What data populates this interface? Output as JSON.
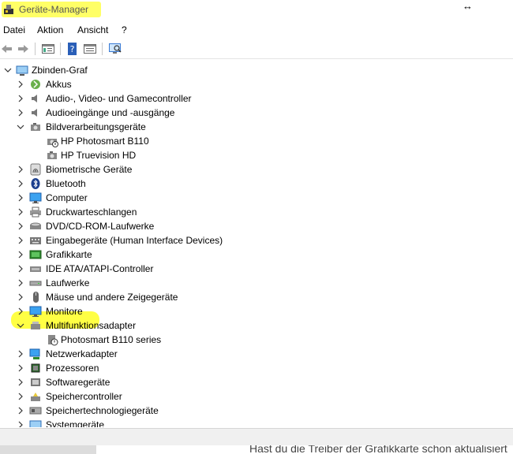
{
  "window": {
    "title": "Geräte-Manager",
    "app_icon": "device-manager-icon",
    "resize_glyph": "↔"
  },
  "menu": {
    "items": [
      "Datei",
      "Aktion",
      "Ansicht",
      "?"
    ]
  },
  "toolbar": {
    "buttons": [
      "back-arrow-icon",
      "forward-arrow-icon",
      "properties-view-icon",
      "help-icon",
      "details-view-icon",
      "scan-hardware-icon"
    ]
  },
  "tree": {
    "root": "Zbinden-Graf",
    "items": [
      {
        "label": "Akkus",
        "icon": "battery-icon",
        "expanded": false
      },
      {
        "label": "Audio-, Video- und Gamecontroller",
        "icon": "speaker-icon",
        "expanded": false
      },
      {
        "label": "Audioeingänge und -ausgänge",
        "icon": "speaker-icon",
        "expanded": false
      },
      {
        "label": "Bildverarbeitungsgeräte",
        "icon": "camera-icon",
        "expanded": true
      },
      {
        "label": "HP Photosmart B110",
        "icon": "camera-warning-icon",
        "child": true
      },
      {
        "label": "HP Truevision HD",
        "icon": "camera-icon",
        "child": true
      },
      {
        "label": "Biometrische Geräte",
        "icon": "fingerprint-icon",
        "expanded": false
      },
      {
        "label": "Bluetooth",
        "icon": "bluetooth-icon",
        "expanded": false
      },
      {
        "label": "Computer",
        "icon": "monitor-icon",
        "expanded": false
      },
      {
        "label": "Druckwarteschlangen",
        "icon": "printer-icon",
        "expanded": false
      },
      {
        "label": "DVD/CD-ROM-Laufwerke",
        "icon": "disc-drive-icon",
        "expanded": false
      },
      {
        "label": "Eingabegeräte (Human Interface Devices)",
        "icon": "keyboard-icon",
        "expanded": false
      },
      {
        "label": "Grafikkarte",
        "icon": "display-adapter-icon",
        "expanded": false,
        "highlighted": true
      },
      {
        "label": "IDE ATA/ATAPI-Controller",
        "icon": "ide-controller-icon",
        "expanded": false
      },
      {
        "label": "Laufwerke",
        "icon": "disk-drive-icon",
        "expanded": false
      },
      {
        "label": "Mäuse und andere Zeigegeräte",
        "icon": "mouse-icon",
        "expanded": false
      },
      {
        "label": "Monitore",
        "icon": "monitor-icon",
        "expanded": false
      },
      {
        "label": "Multifunktionsadapter",
        "icon": "multifunction-icon",
        "expanded": true
      },
      {
        "label": "Photosmart B110 series",
        "icon": "device-warning-icon",
        "child": true
      },
      {
        "label": "Netzwerkadapter",
        "icon": "network-adapter-icon",
        "expanded": false
      },
      {
        "label": "Prozessoren",
        "icon": "processor-icon",
        "expanded": false
      },
      {
        "label": "Softwaregeräte",
        "icon": "software-device-icon",
        "expanded": false
      },
      {
        "label": "Speichercontroller",
        "icon": "storage-controller-icon",
        "expanded": false
      },
      {
        "label": "Speichertechnologiegeräte",
        "icon": "memory-tech-icon",
        "expanded": false
      },
      {
        "label": "Systemgeräte",
        "icon": "system-device-icon",
        "expanded": false
      }
    ]
  },
  "background_text": "Hast du die Treiber der Grafikkarte schon aktualisiert",
  "colors": {
    "highlight": "#ffff44",
    "accent_blue": "#1f7ad6"
  }
}
